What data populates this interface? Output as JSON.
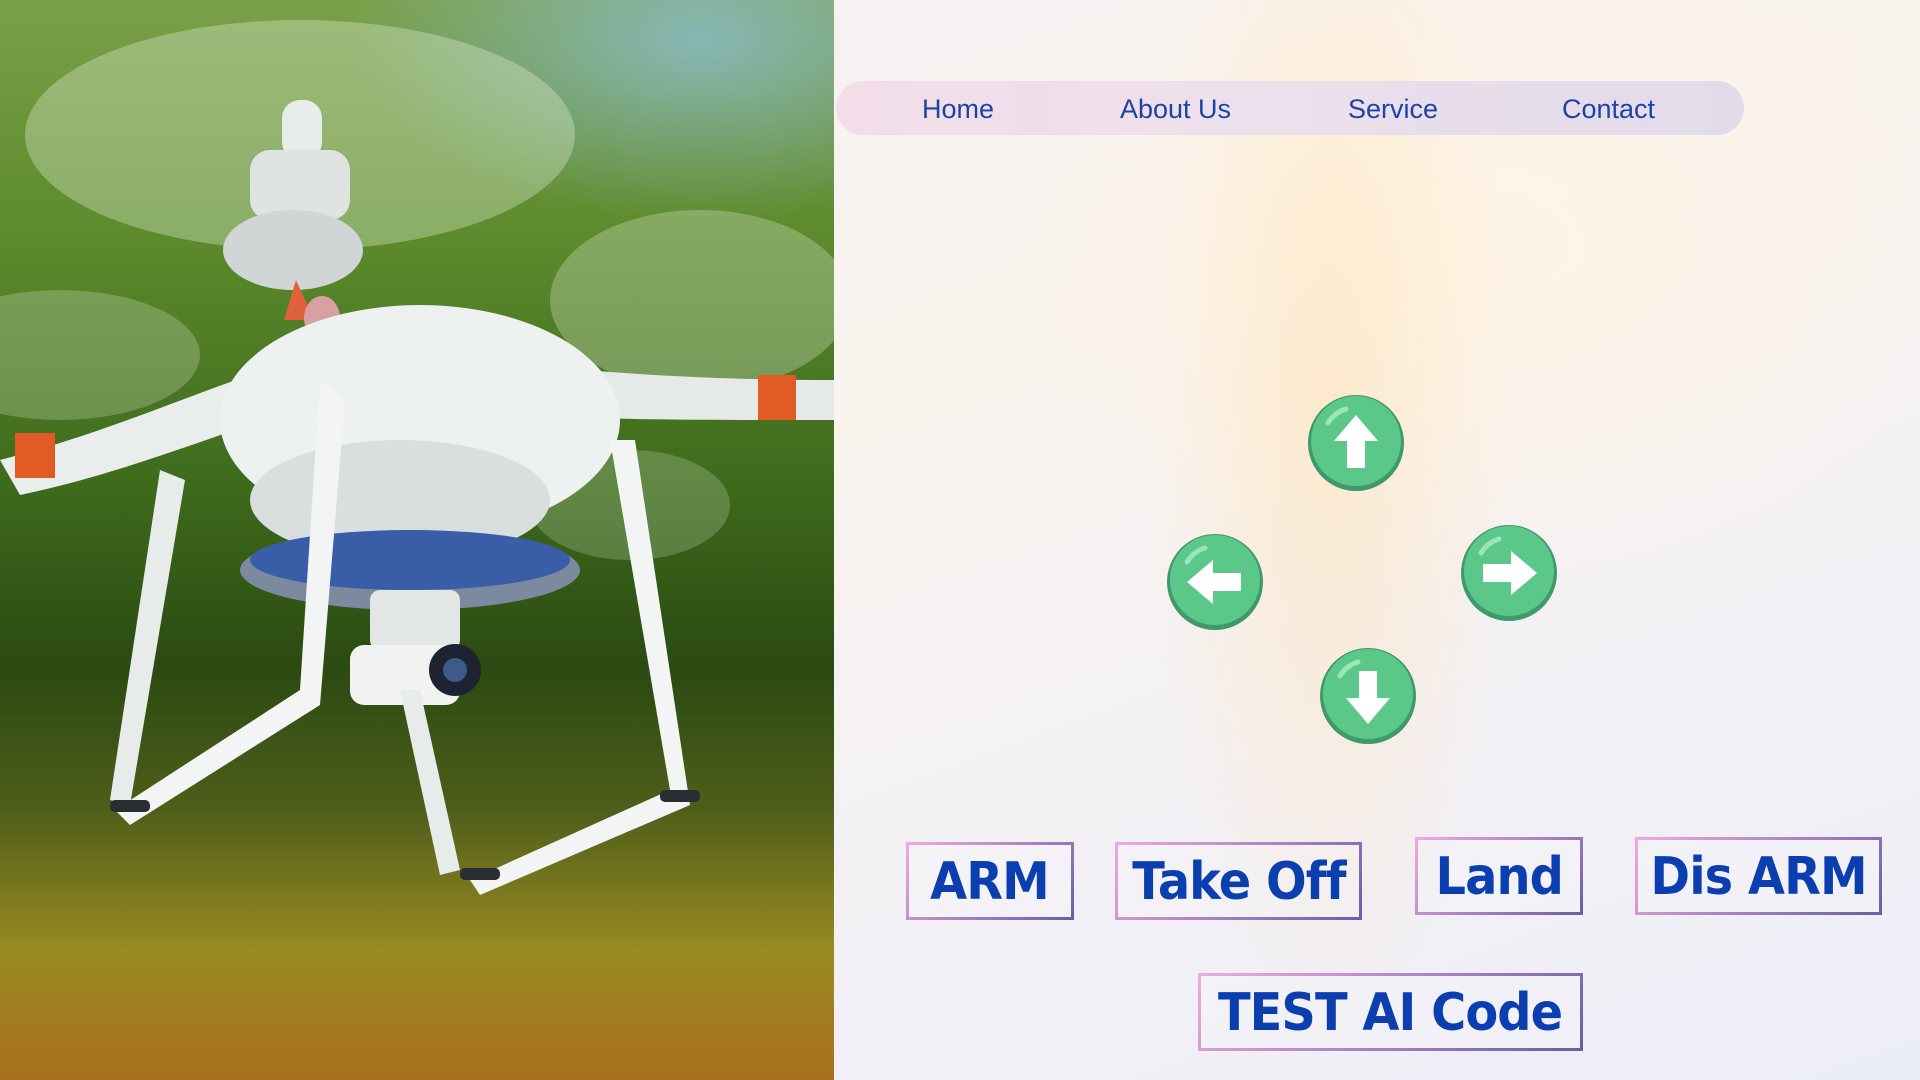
{
  "hero": {
    "image": "drone-photo",
    "alt_subject": "white quadcopter drone with camera gimbal"
  },
  "nav": {
    "items": [
      {
        "id": "home",
        "label": "Home"
      },
      {
        "id": "about",
        "label": "About Us"
      },
      {
        "id": "service",
        "label": "Service"
      },
      {
        "id": "contact",
        "label": "Contact"
      }
    ]
  },
  "controls": {
    "arrows": [
      {
        "direction": "up",
        "icon": "arrow-up-icon"
      },
      {
        "direction": "left",
        "icon": "arrow-left-icon"
      },
      {
        "direction": "right",
        "icon": "arrow-right-icon"
      },
      {
        "direction": "down",
        "icon": "arrow-down-icon"
      }
    ],
    "button_color": "#5bc88a",
    "button_border": "#3e9a6a"
  },
  "actions": {
    "arm": "ARM",
    "takeoff": "Take Off",
    "land": "Land",
    "disarm": "Dis ARM",
    "test": "TEST AI Code"
  },
  "colors": {
    "text_blue": "#0b3fb0",
    "nav_text": "#1f43a3",
    "border_pink": "#f0a8e0",
    "border_purple": "#6a5ea8"
  }
}
